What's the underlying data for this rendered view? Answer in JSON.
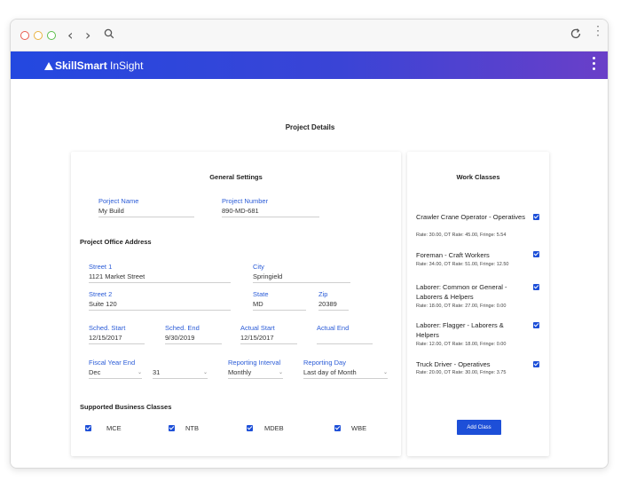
{
  "browser": {
    "dots": [
      "#e95c4f",
      "#e9b240",
      "#5cbf4b"
    ],
    "icons": [
      "back-icon",
      "forward-icon",
      "search-icon",
      "refresh-icon",
      "more-vertical-icon"
    ]
  },
  "app": {
    "logo": {
      "prefix": "SkillSmart",
      "suffix": " InSight"
    },
    "accent_start": "#2348e0",
    "accent_end": "#6a3fc8"
  },
  "page": {
    "title": "Project Details"
  },
  "general": {
    "title": "General Settings",
    "project_name": {
      "label": "Porject Name",
      "value": "My Build"
    },
    "project_number": {
      "label": "Project Number",
      "value": "890-MD-681"
    }
  },
  "address": {
    "title": "Project Office Address",
    "street1": {
      "label": "Street 1",
      "value": "1121 Market Street"
    },
    "city": {
      "label": "City",
      "value": "Springield"
    },
    "street2": {
      "label": "Street 2",
      "value": "Suite 120"
    },
    "state": {
      "label": "State",
      "value": "MD"
    },
    "zip": {
      "label": "Zip",
      "value": "20389"
    }
  },
  "dates": {
    "sched_start": {
      "label": "Sched. Start",
      "value": "12/15/2017"
    },
    "sched_end": {
      "label": "Sched. End",
      "value": "9/30/2019"
    },
    "actual_start": {
      "label": "Actual Start",
      "value": "12/15/2017"
    },
    "actual_end": {
      "label": "Actual End",
      "value": ""
    }
  },
  "fiscal": {
    "label": "Fiscal Year End",
    "month": "Dec",
    "day": "31"
  },
  "reporting": {
    "interval": {
      "label": "Reporting Interval",
      "value": "Monthly"
    },
    "day": {
      "label": "Reporting Day",
      "value": "Last day of Month"
    }
  },
  "business": {
    "title": "Supported Business Classes",
    "classes": [
      {
        "label": "MCE",
        "checked": true
      },
      {
        "label": "NTB",
        "checked": true
      },
      {
        "label": "MDEB",
        "checked": true
      },
      {
        "label": "WBE",
        "checked": true
      }
    ]
  },
  "work_classes": {
    "title": "Work Classes",
    "items": [
      {
        "name": "Crawler Crane Operator - Operatives",
        "rates": "Rate: 30.00, OT Rate: 45.00, Fringe: 5.54",
        "checked": true
      },
      {
        "name": "Foreman - Craft Workers",
        "rates": "Rate: 34.00, OT Rate: 51.00, Fringe: 12.50",
        "checked": true
      },
      {
        "name": "Laborer: Common or General - Laborers & Helpers",
        "rates": "Rate: 18.00, OT Rate: 27.00, Fringe: 0.00",
        "checked": true
      },
      {
        "name": "Laborer: Flagger - Laborers & Helpers",
        "rates": "Rate: 12.00, OT Rate: 18.00, Fringe: 0.00",
        "checked": true
      },
      {
        "name": "Truck Driver - Operatives",
        "rates": "Rate: 20.00, OT Rate: 30.00, Fringe: 3.75",
        "checked": true
      }
    ],
    "add_label": "Add Class"
  }
}
